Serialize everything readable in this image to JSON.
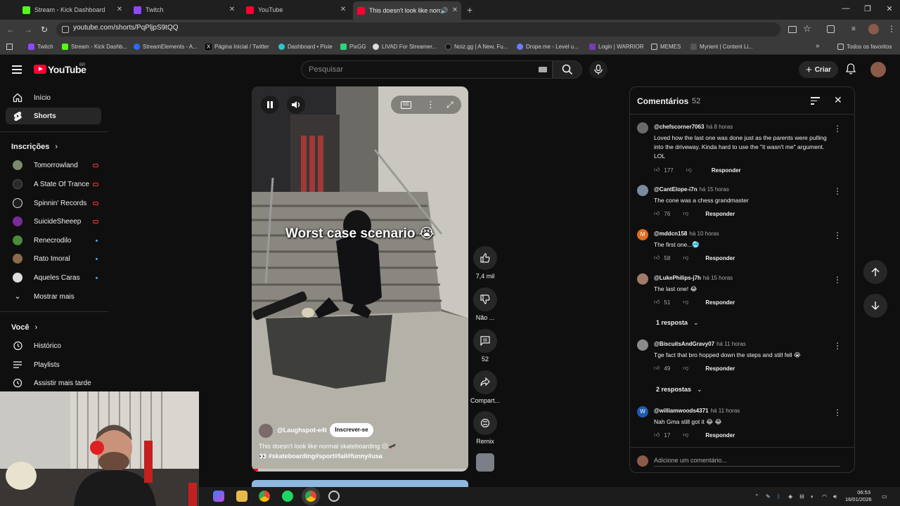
{
  "browser": {
    "tabs": [
      {
        "title": "Stream - Kick Dashboard",
        "color": "#53fc18"
      },
      {
        "title": "Twitch",
        "color": "#9146ff"
      },
      {
        "title": "YouTube",
        "color": "#ff0033"
      },
      {
        "title": "This doesn't look like norm",
        "color": "#ff0033"
      }
    ],
    "url": "youtube.com/shorts/PqPljpS9tQQ",
    "bookmarks": [
      {
        "label": "Twitch",
        "color": "#9146ff"
      },
      {
        "label": "Stream - Kick Dashb...",
        "color": "#53fc18"
      },
      {
        "label": "StreamElements - A...",
        "color": "#2c6bff"
      },
      {
        "label": "Página Inicial / Twitter",
        "color": "#000000"
      },
      {
        "label": "Dashboard • Pixie",
        "color": "#2dc7c7"
      },
      {
        "label": "PixGG",
        "color": "#2dd47a"
      },
      {
        "label": "LIVAD For Streamer...",
        "color": "#dddddd"
      },
      {
        "label": "Noiz.gg | A New, Fu...",
        "color": "#111111"
      },
      {
        "label": "Drope.me - Level u...",
        "color": "#6c7bff"
      },
      {
        "label": "Login | WARRIOR",
        "color": "#7a3ab5"
      },
      {
        "label": "MEMES",
        "color": "#777777"
      },
      {
        "label": "Myrient | Content Li...",
        "color": "#555555"
      }
    ],
    "all_favorites": "Todos os favoritos"
  },
  "youtube": {
    "logo_text": "YouTube",
    "logo_region": "BR",
    "search_placeholder": "Pesquisar",
    "create_label": "Criar"
  },
  "sidebar": {
    "main": [
      {
        "label": "Início",
        "icon": "home-icon"
      },
      {
        "label": "Shorts",
        "icon": "shorts-icon"
      }
    ],
    "subscriptions_title": "Inscrições",
    "subscriptions": [
      {
        "label": "Tomorrowland",
        "status": "live",
        "color": "#7b8a6a"
      },
      {
        "label": "A State Of Trance",
        "status": "live",
        "color": "#222222"
      },
      {
        "label": "Spinnin' Records",
        "status": "live",
        "color": "#1e1e1e"
      },
      {
        "label": "SuicideSheeep",
        "status": "live",
        "color": "#7b2a9a"
      },
      {
        "label": "Renecrodilo",
        "status": "new",
        "color": "#4a8a3a"
      },
      {
        "label": "Rato Imoral",
        "status": "new",
        "color": "#8a6a4a"
      },
      {
        "label": "Aqueles Caras",
        "status": "new",
        "color": "#dddddd"
      }
    ],
    "show_more": "Mostrar mais",
    "you_title": "Você",
    "you": [
      {
        "label": "Histórico",
        "icon": "history-icon"
      },
      {
        "label": "Playlists",
        "icon": "playlists-icon"
      },
      {
        "label": "Assistir mais tarde",
        "icon": "watch-later-icon"
      }
    ]
  },
  "short": {
    "caption": "Worst case scenario 😭",
    "channel": "@Laughspot-e4t",
    "subscribe": "Inscrever-se",
    "title": "This doesn't look like normal skateboarding 😕🛹",
    "tags": "👀 #skateboarding#sport#fail#funny#usa",
    "progress": 0.03,
    "actions": {
      "likes": "7,4 mil",
      "dislike": "Não ...",
      "comments": "52",
      "share": "Compart...",
      "remix": "Remix"
    }
  },
  "comments": {
    "title": "Comentários",
    "count": "52",
    "add_placeholder": "Adicione um comentário...",
    "reply_label": "Responder",
    "items": [
      {
        "author": "@chefscorner7063",
        "time": "há 8 horas",
        "text": "Loved how the last one was done just as the parents were pulling into the driveway. Kinda hard to use the \"it wasn't me\" argument.  LOL",
        "likes": "177",
        "avatar_color": "#6a6a6a",
        "avatar_letter": "",
        "replies": ""
      },
      {
        "author": "@CantElope-i7n",
        "time": "há 15 horas",
        "text": "The cone was a chess grandmaster",
        "likes": "76",
        "avatar_color": "#7a8aa0",
        "avatar_letter": "",
        "replies": ""
      },
      {
        "author": "@mddcn158",
        "time": "há 10 horas",
        "text": "The first one...🥶",
        "likes": "58",
        "avatar_color": "#e36c1e",
        "avatar_letter": "M",
        "replies": ""
      },
      {
        "author": "@LukePhilips-j7h",
        "time": "há 15 horas",
        "text": "The last one! 😂",
        "likes": "51",
        "avatar_color": "#a07a6a",
        "avatar_letter": "",
        "replies": "1 resposta"
      },
      {
        "author": "@BiscuitsAndGravy07",
        "time": "há 11 horas",
        "text": "Tge fact that bro hopped down the steps and still fell 😭",
        "likes": "49",
        "avatar_color": "#8a8a8a",
        "avatar_letter": "",
        "replies": "2 respostas"
      },
      {
        "author": "@williamwoods4371",
        "time": "há 11 horas",
        "text": "Nah Gma still got it 😂 😂",
        "likes": "17",
        "avatar_color": "#1e5ab4",
        "avatar_letter": "W",
        "replies": ""
      }
    ]
  },
  "taskbar": {
    "time": "06:53",
    "date": "16/01/2026"
  }
}
